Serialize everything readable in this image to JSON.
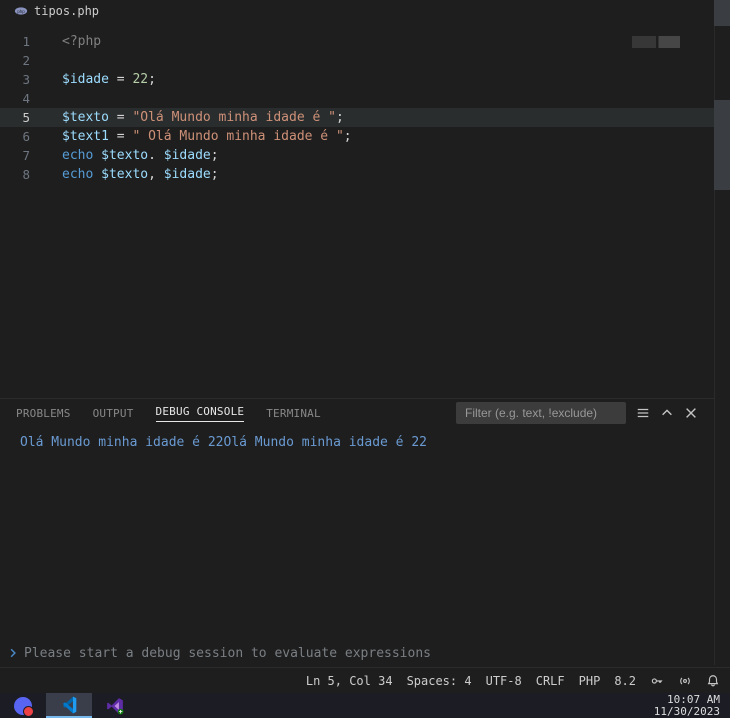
{
  "tab": {
    "icon": "php-icon",
    "title": "tipos.php"
  },
  "code": [
    {
      "n": 1,
      "tokens": [
        {
          "c": "tok-php",
          "t": "<?php"
        }
      ]
    },
    {
      "n": 2,
      "tokens": []
    },
    {
      "n": 3,
      "tokens": [
        {
          "c": "tok-var",
          "t": "$idade"
        },
        {
          "c": "tok-op",
          "t": " = "
        },
        {
          "c": "tok-num",
          "t": "22"
        },
        {
          "c": "tok-punc",
          "t": ";"
        }
      ]
    },
    {
      "n": 4,
      "tokens": []
    },
    {
      "n": 5,
      "active": true,
      "tokens": [
        {
          "c": "tok-var",
          "t": "$texto"
        },
        {
          "c": "tok-op",
          "t": " = "
        },
        {
          "c": "tok-str",
          "t": "\"Olá Mundo minha idade é \""
        },
        {
          "c": "tok-punc",
          "t": ";"
        }
      ]
    },
    {
      "n": 6,
      "tokens": [
        {
          "c": "tok-var",
          "t": "$text1"
        },
        {
          "c": "tok-op",
          "t": " = "
        },
        {
          "c": "tok-str",
          "t": "\" Olá Mundo minha idade é \""
        },
        {
          "c": "tok-punc",
          "t": ";"
        }
      ]
    },
    {
      "n": 7,
      "tokens": [
        {
          "c": "tok-kw",
          "t": "echo"
        },
        {
          "c": "tok-op",
          "t": " "
        },
        {
          "c": "tok-var",
          "t": "$texto"
        },
        {
          "c": "tok-punc",
          "t": ". "
        },
        {
          "c": "tok-var",
          "t": "$idade"
        },
        {
          "c": "tok-punc",
          "t": ";"
        }
      ]
    },
    {
      "n": 8,
      "tokens": [
        {
          "c": "tok-kw",
          "t": "echo"
        },
        {
          "c": "tok-op",
          "t": " "
        },
        {
          "c": "tok-var",
          "t": "$texto"
        },
        {
          "c": "tok-punc",
          "t": ", "
        },
        {
          "c": "tok-var",
          "t": "$idade"
        },
        {
          "c": "tok-punc",
          "t": ";"
        }
      ]
    }
  ],
  "panel": {
    "tabs": {
      "problems": "PROBLEMS",
      "output": "OUTPUT",
      "debug": "DEBUG CONSOLE",
      "terminal": "TERMINAL"
    },
    "active": "debug",
    "filter_placeholder": "Filter (e.g. text, !exclude)",
    "output": "Olá Mundo minha idade é 22Olá Mundo minha idade é 22",
    "repl_placeholder": "Please start a debug session to evaluate expressions"
  },
  "status": {
    "cursor": "Ln 5, Col 34",
    "spaces": "Spaces: 4",
    "encoding": "UTF-8",
    "eol": "CRLF",
    "lang": "PHP",
    "version": "8.2"
  },
  "taskbar": {
    "time": "10:07 AM",
    "date": "11/30/2023"
  }
}
